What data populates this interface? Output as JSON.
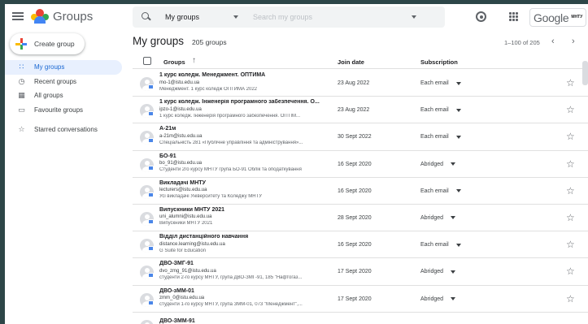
{
  "app": {
    "title": "Groups",
    "colors": {
      "brand_blue": "#4285f4",
      "brand_red": "#ea4335",
      "brand_yellow": "#fbbc04",
      "brand_green": "#34a853",
      "active_bg": "#e8f0fe",
      "active_text": "#1967d2"
    }
  },
  "header": {
    "scope": "My groups",
    "search_placeholder": "Search my groups",
    "settings_icon": "gear-icon",
    "apps_icon": "apps-grid-icon",
    "account_logo": "Google",
    "account_badge": "MНТУ"
  },
  "sidebar": {
    "create_label": "Create group",
    "items": [
      {
        "label": "My groups",
        "icon": "∷"
      },
      {
        "label": "Recent groups",
        "icon": "◷"
      },
      {
        "label": "All groups",
        "icon": "▦"
      },
      {
        "label": "Favourite groups",
        "icon": "▭"
      },
      {
        "label": "Starred conversations",
        "icon": "☆"
      }
    ]
  },
  "main": {
    "title": "My groups",
    "count": "205 groups",
    "pager": "1–100 of 205",
    "prev_icon": "‹",
    "next_icon": "›",
    "columns": {
      "groups": "Groups",
      "sort": "↑",
      "join": "Join date",
      "subscription": "Subscription"
    },
    "rows": [
      {
        "name": "1 курс коледж. Менеджмент. ОПТИМА",
        "email": "mo-1@istu.edu.ua",
        "desc": "Менеджмент. 1 курс коледж ОПТИМА 2022",
        "date": "23 Aug 2022",
        "sub": "Each email"
      },
      {
        "name": "1 курс коледж. Інженерія програмного забезпечення. О...",
        "email": "ipzo-1@istu.edu.ua",
        "desc": "1 курс коледж. Інженерія програмного забезпечення. ОПТІМ...",
        "date": "23 Aug 2022",
        "sub": "Each email"
      },
      {
        "name": "А-21м",
        "email": "a-21m@istu.edu.ua",
        "desc": "Спеціальність 281 «Публічне управління та адміністрування»...",
        "date": "30 Sept 2022",
        "sub": "Each email"
      },
      {
        "name": "БО-91",
        "email": "bo_91@istu.edu.ua",
        "desc": "Студенти 2го курсу МНТУ група БО-91 Облік та оподаткування",
        "date": "16 Sept 2020",
        "sub": "Abridged"
      },
      {
        "name": "Викладачі МНТУ",
        "email": "lecturers@istu.edu.ua",
        "desc": "Усі викладачі Університету та Коледжу МНТУ",
        "date": "16 Sept 2020",
        "sub": "Each email"
      },
      {
        "name": "Випускники МНТУ 2021",
        "email": "uni_alumni@istu.edu.ua",
        "desc": "Випускники МНТУ 2021",
        "date": "28 Sept 2020",
        "sub": "Abridged"
      },
      {
        "name": "Відділ дистанційного навчання",
        "email": "distance.learning@istu.edu.ua",
        "desc": "G Suite for Education",
        "date": "16 Sept 2020",
        "sub": "Each email"
      },
      {
        "name": "ДВО-ЗМГ-91",
        "email": "dvo_zmg_91@istu.edu.ua",
        "desc": "студенти 2-го курсу МНТУ, група ДВО-ЗМГ-91, 185 \"Нафтогаз...",
        "date": "17 Sept 2020",
        "sub": "Abridged"
      },
      {
        "name": "ДВО-зММ-01",
        "email": "zmm_0@istu.edu.ua",
        "desc": "студенти 1-го курсу МНТУ, група ЗММ-01, 073 \"Менеджмент\",...",
        "date": "17 Sept 2020",
        "sub": "Abridged"
      },
      {
        "name": "ДВО-ЗММ-91",
        "email": "",
        "desc": "",
        "date": "",
        "sub": ""
      }
    ]
  }
}
